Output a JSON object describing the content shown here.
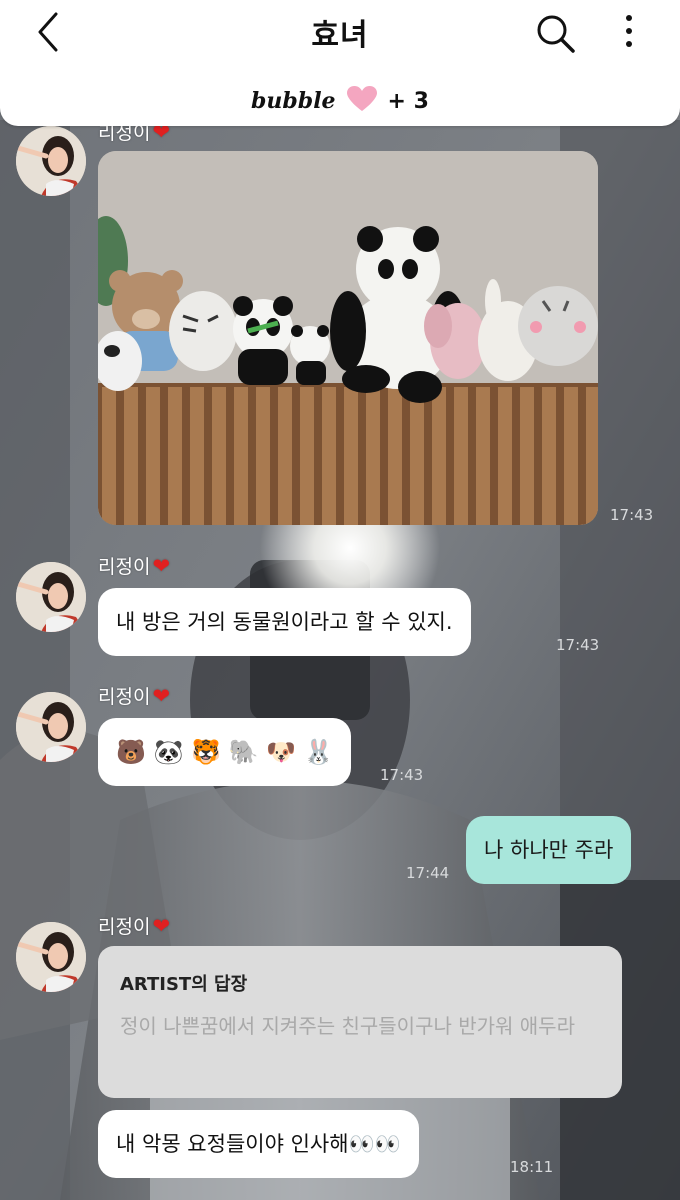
{
  "header": {
    "back_icon": "chevron-left-icon",
    "title": "효녀",
    "search_icon": "search-icon",
    "more_icon": "more-vertical-icon",
    "subscription": {
      "brand": "bubble",
      "heart_icon": "pink-heart-icon",
      "count": "+ 3"
    }
  },
  "messages": [
    {
      "type": "image",
      "sender": "리정이",
      "image": "stuffed-animals-on-shelf-photo",
      "time": "17:43"
    },
    {
      "type": "text",
      "sender": "리정이",
      "text": "내 방은 거의 동물원이라고 할 수 있지.",
      "time": "17:43"
    },
    {
      "type": "emoji",
      "sender": "리정이",
      "text": "🐻 🐼 🐯 🐘 🐶 🐰",
      "time": "17:43"
    },
    {
      "type": "text",
      "mine": true,
      "text": "나 하나만 주라",
      "time": "17:44"
    },
    {
      "type": "reply",
      "sender": "리정이",
      "reply_title": "ARTIST의 답장",
      "reply_body": "정이 나쁜꿈에서 지켜주는 친구들이구나 반가워 애두라",
      "text": "내 악몽 요정들이야 인사해👀👀",
      "time": "18:11"
    }
  ],
  "colors": {
    "my_bubble": "#a8e6db",
    "other_bubble": "#ffffff",
    "reply_card": "#dcdcdc",
    "name_heart": "#e02020"
  }
}
